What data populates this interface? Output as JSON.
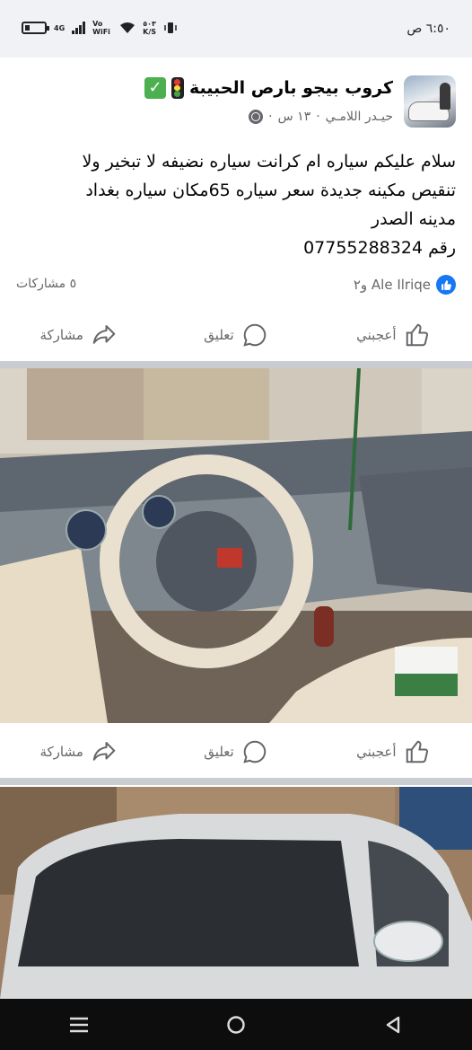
{
  "status_bar": {
    "time": "٦:٥٠ ص",
    "battery_level": 0.25,
    "network": "4G",
    "volte": "Vo WiFi",
    "speed_value": "٥٠٣",
    "speed_unit": "K/S"
  },
  "post": {
    "group_name": "كروب بيجو بارص الحبيبة",
    "author": "حيـدر اللامـي",
    "time": "١٣ س",
    "text_lines": [
      "سلام عليكم سياره ام كرانت سياره نضيفه لا تبخير ولا",
      "تنقيص مكينه جديدة سعر سياره 65مكان سياره بغداد",
      "مدينه الصدر",
      "رقم 07755288324"
    ],
    "reactions_label": "Ale Ilriqe و٢",
    "shares_label": "٥ مشاركات"
  },
  "actions": {
    "like": "أعجبني",
    "comment": "تعليق",
    "share": "مشاركة"
  },
  "icons": {
    "like": "thumbs-up-icon",
    "comment": "comment-bubble-icon",
    "share": "share-arrow-icon",
    "privacy": "globe-icon"
  },
  "colors": {
    "facebook_blue": "#1877f2",
    "secondary_text": "#65676b",
    "divider": "#c9ccd1"
  }
}
